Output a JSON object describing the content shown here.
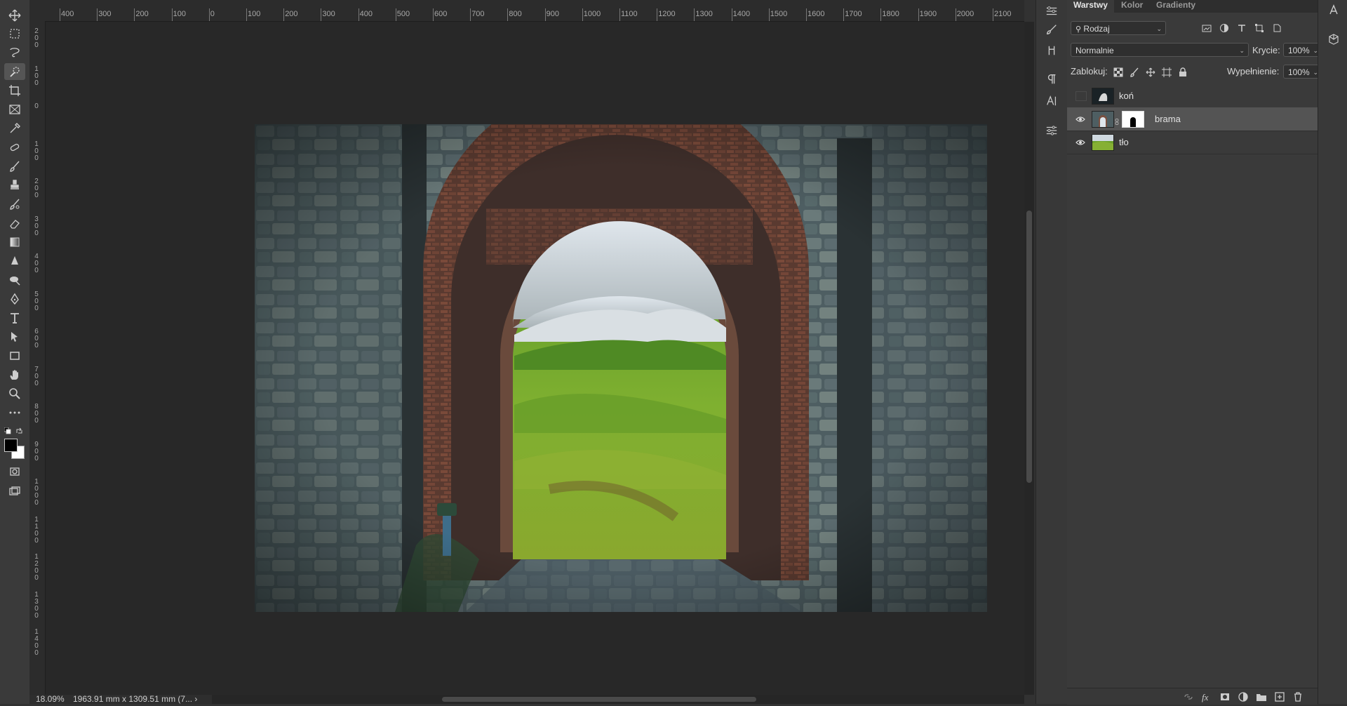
{
  "ruler": {
    "top_labels": [
      "400",
      "300",
      "200",
      "100",
      "0",
      "100",
      "200",
      "300",
      "400",
      "500",
      "600",
      "700",
      "800",
      "900",
      "1000",
      "1100",
      "1200",
      "1300",
      "1400",
      "1500",
      "1600",
      "1700",
      "1800",
      "1900",
      "2000",
      "2100"
    ],
    "left_labels": [
      "200",
      "100",
      "0",
      "100",
      "200",
      "300",
      "400",
      "500",
      "600",
      "700",
      "800",
      "900",
      "1000",
      "1100",
      "1200",
      "1300",
      "1400"
    ]
  },
  "status": {
    "zoom": "18.09%",
    "doc_size": "1963.91 mm x 1309.51 mm (7... ›"
  },
  "panel": {
    "tabs": [
      "Warstwy",
      "Kolor",
      "Gradienty"
    ],
    "filter_label": "Rodzaj",
    "blend_mode": "Normalnie",
    "opacity_label": "Krycie:",
    "opacity_value": "100%",
    "lock_label": "Zablokuj:",
    "fill_label": "Wypełnienie:",
    "fill_value": "100%"
  },
  "layers": [
    {
      "name": "koń",
      "visible": false,
      "selected": false,
      "has_mask": false
    },
    {
      "name": "brama",
      "visible": true,
      "selected": true,
      "has_mask": true
    },
    {
      "name": "tło",
      "visible": true,
      "selected": false,
      "has_mask": false
    }
  ],
  "colors": {
    "accent_selected": "#545454",
    "foreground_swatch": "#000000",
    "background_swatch": "#ffffff"
  }
}
